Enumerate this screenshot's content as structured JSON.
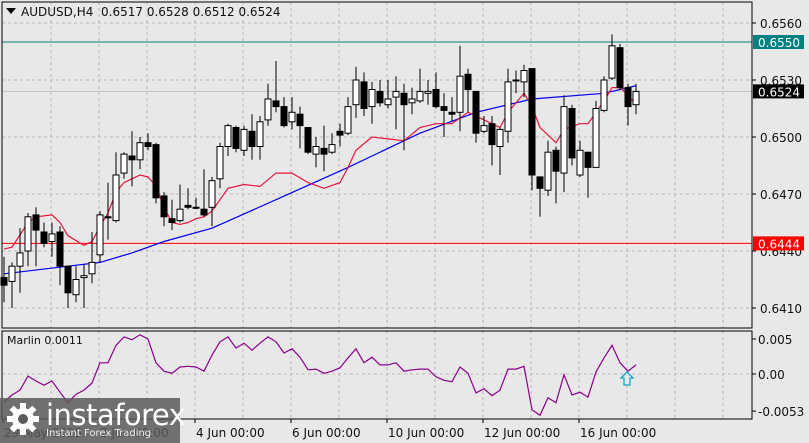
{
  "header": {
    "symbol": "AUDUSD,H4",
    "open": "0.6517",
    "high": "0.6528",
    "low": "0.6512",
    "close": "0.6524"
  },
  "indicator": {
    "label": "Marlin 0.0011"
  },
  "logo": {
    "name": "instaforex",
    "tagline": "Instant Forex Trading"
  },
  "colors": {
    "background": "#e8e8e8",
    "ma_fast": "#e8133c",
    "ma_slow": "#0000ee",
    "resistance": "#008080",
    "support": "#ff0000",
    "marlin": "#8b008b",
    "arrow": "#1aa3c7"
  },
  "chart_data": {
    "type": "candlestick",
    "title": "AUDUSD,H4",
    "y_ticks": [
      "0.6560",
      "0.6530",
      "0.6500",
      "0.6470",
      "0.6440",
      "0.6410"
    ],
    "ylim": [
      0.64,
      0.6572
    ],
    "x_ticks": [
      "29 May 2025",
      "2 Jun 00:00",
      "4 Jun 00:00",
      "6 Jun 00:00",
      "10 Jun 00:00",
      "12 Jun 00:00",
      "16 Jun 00:00"
    ],
    "levels": [
      {
        "price": 0.655,
        "label": "0.6550",
        "kind": "resistance"
      },
      {
        "price": 0.6444,
        "label": "0.6444",
        "kind": "support"
      },
      {
        "price": 0.6524,
        "label": "0.6524",
        "kind": "current"
      }
    ],
    "candles": [
      [
        0.6426,
        0.6437,
        0.6413,
        0.6422
      ],
      [
        0.6424,
        0.6434,
        0.641,
        0.6432
      ],
      [
        0.6432,
        0.6452,
        0.6418,
        0.6439
      ],
      [
        0.644,
        0.646,
        0.6432,
        0.6458
      ],
      [
        0.6459,
        0.6463,
        0.6432,
        0.6451
      ],
      [
        0.645,
        0.6455,
        0.6442,
        0.6444
      ],
      [
        0.6445,
        0.6455,
        0.6437,
        0.6449
      ],
      [
        0.645,
        0.6453,
        0.6422,
        0.6432
      ],
      [
        0.6432,
        0.6432,
        0.641,
        0.6418
      ],
      [
        0.6417,
        0.6432,
        0.6413,
        0.6425
      ],
      [
        0.6426,
        0.6433,
        0.641,
        0.6427
      ],
      [
        0.6428,
        0.645,
        0.6423,
        0.6434
      ],
      [
        0.6438,
        0.6461,
        0.6434,
        0.6459
      ],
      [
        0.6458,
        0.6476,
        0.6446,
        0.6458
      ],
      [
        0.6456,
        0.6492,
        0.6455,
        0.648
      ],
      [
        0.6481,
        0.6492,
        0.6478,
        0.6491
      ],
      [
        0.649,
        0.6503,
        0.6474,
        0.6488
      ],
      [
        0.6488,
        0.65,
        0.6483,
        0.6497
      ],
      [
        0.6497,
        0.6502,
        0.6493,
        0.6495
      ],
      [
        0.6496,
        0.6497,
        0.6465,
        0.6468
      ],
      [
        0.6469,
        0.6471,
        0.6453,
        0.6458
      ],
      [
        0.6457,
        0.6467,
        0.6451,
        0.6455
      ],
      [
        0.6456,
        0.6475,
        0.6455,
        0.6462
      ],
      [
        0.6464,
        0.6473,
        0.6462,
        0.6463
      ],
      [
        0.6463,
        0.6468,
        0.6462,
        0.6463
      ],
      [
        0.6462,
        0.6483,
        0.6458,
        0.6459
      ],
      [
        0.6463,
        0.6479,
        0.6453,
        0.6477
      ],
      [
        0.6478,
        0.6497,
        0.6473,
        0.6495
      ],
      [
        0.6495,
        0.6507,
        0.649,
        0.6506
      ],
      [
        0.6505,
        0.6506,
        0.6492,
        0.6494
      ],
      [
        0.6493,
        0.6506,
        0.649,
        0.6504
      ],
      [
        0.6503,
        0.6512,
        0.6488,
        0.6495
      ],
      [
        0.6495,
        0.6511,
        0.6488,
        0.6508
      ],
      [
        0.6509,
        0.6528,
        0.6506,
        0.652
      ],
      [
        0.6519,
        0.654,
        0.6513,
        0.6516
      ],
      [
        0.6516,
        0.6521,
        0.6505,
        0.6506
      ],
      [
        0.6508,
        0.6521,
        0.6504,
        0.6513
      ],
      [
        0.6512,
        0.6516,
        0.6494,
        0.6506
      ],
      [
        0.6505,
        0.6505,
        0.6491,
        0.6492
      ],
      [
        0.6491,
        0.65,
        0.6484,
        0.6495
      ],
      [
        0.6494,
        0.6506,
        0.6482,
        0.6491
      ],
      [
        0.6492,
        0.6502,
        0.6491,
        0.6496
      ],
      [
        0.6503,
        0.6507,
        0.6495,
        0.6501
      ],
      [
        0.6502,
        0.6521,
        0.6501,
        0.6516
      ],
      [
        0.6517,
        0.6537,
        0.651,
        0.653
      ],
      [
        0.6529,
        0.6534,
        0.6511,
        0.6515
      ],
      [
        0.6516,
        0.6529,
        0.6507,
        0.6525
      ],
      [
        0.6524,
        0.653,
        0.6516,
        0.6518
      ],
      [
        0.6517,
        0.653,
        0.6515,
        0.652
      ],
      [
        0.6521,
        0.6532,
        0.6504,
        0.6524
      ],
      [
        0.6523,
        0.6528,
        0.6493,
        0.6517
      ],
      [
        0.6518,
        0.6526,
        0.6512,
        0.652
      ],
      [
        0.6519,
        0.6536,
        0.6518,
        0.6524
      ],
      [
        0.6523,
        0.653,
        0.6517,
        0.6524
      ],
      [
        0.6525,
        0.6534,
        0.6515,
        0.6516
      ],
      [
        0.6516,
        0.6523,
        0.65,
        0.6514
      ],
      [
        0.6513,
        0.6521,
        0.6508,
        0.6512
      ],
      [
        0.6513,
        0.6548,
        0.6503,
        0.6532
      ],
      [
        0.6533,
        0.6536,
        0.6513,
        0.6525
      ],
      [
        0.6524,
        0.6524,
        0.6497,
        0.6502
      ],
      [
        0.6503,
        0.6511,
        0.6502,
        0.6506
      ],
      [
        0.6507,
        0.6511,
        0.6485,
        0.6496
      ],
      [
        0.6495,
        0.6505,
        0.648,
        0.6504
      ],
      [
        0.6503,
        0.6536,
        0.6497,
        0.6529
      ],
      [
        0.653,
        0.6535,
        0.6523,
        0.653
      ],
      [
        0.6529,
        0.6538,
        0.6521,
        0.6535
      ],
      [
        0.6536,
        0.6536,
        0.6472,
        0.648
      ],
      [
        0.6479,
        0.6479,
        0.6458,
        0.6473
      ],
      [
        0.6472,
        0.6498,
        0.6469,
        0.6492
      ],
      [
        0.6493,
        0.6495,
        0.6465,
        0.6482
      ],
      [
        0.6481,
        0.6522,
        0.6471,
        0.6516
      ],
      [
        0.6515,
        0.6517,
        0.6485,
        0.6489
      ],
      [
        0.648,
        0.6498,
        0.6479,
        0.6493
      ],
      [
        0.6492,
        0.6492,
        0.6468,
        0.6484
      ],
      [
        0.6484,
        0.6519,
        0.6484,
        0.6515
      ],
      [
        0.6514,
        0.6532,
        0.6513,
        0.653
      ],
      [
        0.6531,
        0.6554,
        0.653,
        0.6548
      ],
      [
        0.6547,
        0.6549,
        0.6525,
        0.6526
      ],
      [
        0.6526,
        0.6528,
        0.6506,
        0.6516
      ],
      [
        0.6517,
        0.6528,
        0.6512,
        0.6524
      ]
    ],
    "ma_fast": [
      [
        0,
        0.6441
      ],
      [
        1,
        0.6442
      ],
      [
        3,
        0.6455
      ],
      [
        4,
        0.6458
      ],
      [
        6,
        0.6459
      ],
      [
        7,
        0.6455
      ],
      [
        8,
        0.6448
      ],
      [
        10,
        0.6443
      ],
      [
        11,
        0.6445
      ],
      [
        12,
        0.6453
      ],
      [
        13,
        0.646
      ],
      [
        14,
        0.6471
      ],
      [
        15,
        0.6476
      ],
      [
        17,
        0.648
      ],
      [
        18,
        0.6479
      ],
      [
        19,
        0.6474
      ],
      [
        20,
        0.6463
      ],
      [
        21,
        0.6455
      ],
      [
        22,
        0.6454
      ],
      [
        23,
        0.6455
      ],
      [
        24,
        0.6457
      ],
      [
        25,
        0.6458
      ],
      [
        26,
        0.6461
      ],
      [
        27,
        0.6467
      ],
      [
        28,
        0.6473
      ],
      [
        30,
        0.6475
      ],
      [
        32,
        0.6474
      ],
      [
        34,
        0.6481
      ],
      [
        36,
        0.6481
      ],
      [
        38,
        0.6476
      ],
      [
        40,
        0.6473
      ],
      [
        42,
        0.6476
      ],
      [
        43,
        0.6484
      ],
      [
        44,
        0.6493
      ],
      [
        46,
        0.65
      ],
      [
        48,
        0.6499
      ],
      [
        50,
        0.6498
      ],
      [
        52,
        0.6505
      ],
      [
        54,
        0.6507
      ],
      [
        56,
        0.6507
      ],
      [
        58,
        0.6513
      ],
      [
        60,
        0.6509
      ],
      [
        62,
        0.6505
      ],
      [
        63,
        0.6513
      ],
      [
        64,
        0.6518
      ],
      [
        65,
        0.6523
      ],
      [
        66,
        0.6516
      ],
      [
        67,
        0.6505
      ],
      [
        68,
        0.6501
      ],
      [
        69,
        0.6497
      ],
      [
        70,
        0.6504
      ],
      [
        72,
        0.6507
      ],
      [
        73,
        0.6507
      ],
      [
        74,
        0.6513
      ],
      [
        75,
        0.6519
      ],
      [
        76,
        0.6526
      ],
      [
        77,
        0.6526
      ],
      [
        78,
        0.6522
      ],
      [
        79,
        0.6517
      ]
    ],
    "ma_slow": [
      [
        0,
        0.6428
      ],
      [
        8,
        0.6432
      ],
      [
        12,
        0.6434
      ],
      [
        16,
        0.6439
      ],
      [
        20,
        0.6445
      ],
      [
        26,
        0.6452
      ],
      [
        34,
        0.6467
      ],
      [
        43,
        0.6484
      ],
      [
        52,
        0.6502
      ],
      [
        59,
        0.6513
      ],
      [
        66,
        0.652
      ],
      [
        75,
        0.6523
      ],
      [
        79,
        0.6527
      ]
    ],
    "marlin": {
      "name": "Marlin",
      "y_ticks": [
        "0.005",
        "0.00",
        "-0.0053"
      ],
      "ylim": [
        -0.006,
        0.006
      ],
      "values": [
        -0.004,
        -0.003,
        -0.0023,
        -0.0003,
        -0.001,
        -0.0016,
        -0.001,
        -0.0026,
        -0.0041,
        -0.0029,
        -0.0023,
        -0.0013,
        0.0016,
        0.0016,
        0.0041,
        0.0053,
        0.0049,
        0.0056,
        0.005,
        0.0016,
        0.0004,
        0.0001,
        0.001,
        0.0011,
        0.001,
        0.0004,
        0.0027,
        0.0046,
        0.0053,
        0.0037,
        0.0044,
        0.0034,
        0.0044,
        0.0053,
        0.0046,
        0.003,
        0.0036,
        0.0024,
        0.0006,
        0.0007,
        0.0001,
        0.0004,
        0.0009,
        0.0023,
        0.0036,
        0.0016,
        0.0024,
        0.0013,
        0.0013,
        0.0016,
        0.0004,
        0.0006,
        0.0007,
        0.0007,
        -0.0004,
        -0.0009,
        -0.0011,
        0.001,
        0.0001,
        -0.0027,
        -0.0021,
        -0.0031,
        -0.0023,
        0.0007,
        0.0007,
        0.0011,
        -0.0051,
        -0.0059,
        -0.0034,
        -0.0041,
        -0.0001,
        -0.003,
        -0.0026,
        -0.0033,
        0.0003,
        0.0023,
        0.0041,
        0.0016,
        0.0004,
        0.0013
      ],
      "signal_arrow_index": 78
    }
  }
}
